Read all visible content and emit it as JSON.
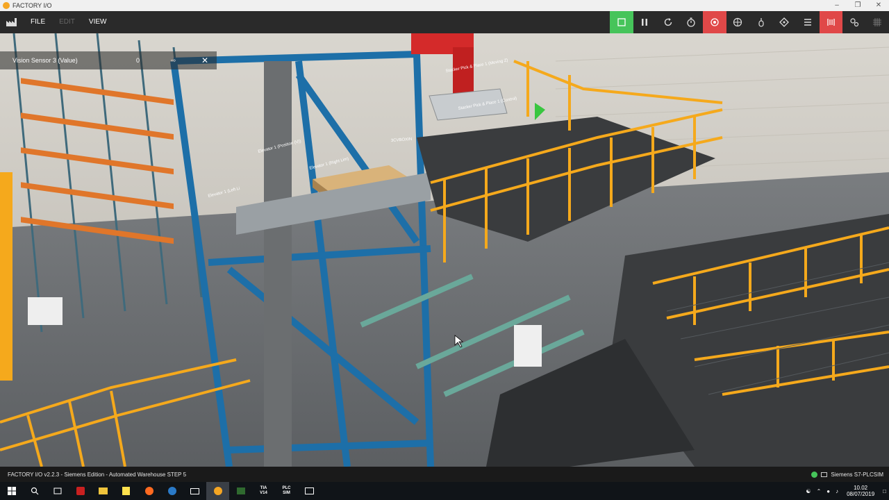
{
  "window": {
    "title": "FACTORY I/O"
  },
  "menu": {
    "file": "FILE",
    "edit": "EDIT",
    "view": "VIEW"
  },
  "toolbar": [
    "play-icon",
    "pause-icon",
    "reset-icon",
    "timer-icon",
    "record-icon",
    "camera-fly-icon",
    "camera-first-person-icon",
    "pin-icon",
    "list-icon",
    "sensor-view-icon",
    "drivers-icon",
    "grid-icon"
  ],
  "sensor_panel": {
    "name": "Vision Sensor 3 (Value)",
    "value": "0"
  },
  "scene_labels": {
    "label1": "Elevator 1 (Position (V))",
    "label2": "Elevator 1 (Right Lim)",
    "label3": "Elevator 1 (Left Li",
    "label4": "3CVBOXIN",
    "label5": "Stacker Pick & Place 1 (Moving Z)",
    "label6": "Stacker Pick & Place 1 (Control)"
  },
  "statusbar": {
    "left": "FACTORY I/O v2.2.3 - Siemens Edition - Automated Warehouse STEP 5",
    "right": "Siemens S7-PLCSIM"
  },
  "taskbar": {
    "time": "10.02",
    "date": "08/07/2019",
    "apps": [
      "TIA V14",
      "PLC SIM"
    ]
  },
  "colors": {
    "accent_green": "#46c45a",
    "accent_red": "#e04848",
    "rail_orange": "#f5a91c",
    "steel_blue": "#1d6fa8"
  }
}
